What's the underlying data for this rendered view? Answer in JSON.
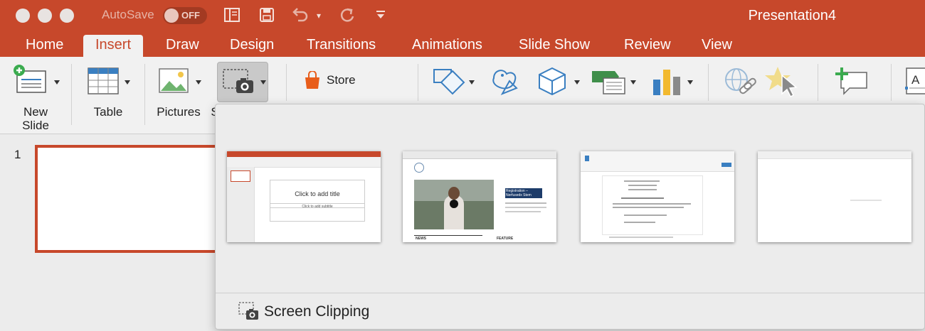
{
  "titlebar": {
    "autosave_label": "AutoSave",
    "toggle_state": "OFF",
    "document_title": "Presentation4"
  },
  "tabs": [
    {
      "label": "Home"
    },
    {
      "label": "Insert"
    },
    {
      "label": "Draw"
    },
    {
      "label": "Design"
    },
    {
      "label": "Transitions"
    },
    {
      "label": "Animations"
    },
    {
      "label": "Slide Show"
    },
    {
      "label": "Review"
    },
    {
      "label": "View"
    }
  ],
  "active_tab": "Insert",
  "ribbon": {
    "new_slide_line1": "New",
    "new_slide_line2": "Slide",
    "table_label": "Table",
    "pictures_label": "Pictures",
    "screenshot_label_partial": "S",
    "store_label": "Store"
  },
  "slides_panel": {
    "slide_number": "1"
  },
  "screenshot_dropdown": {
    "thumb1_title": "Click to add title",
    "thumb1_subtitle": "Click to add subtitle",
    "thumb2_heading": "Registration – Nerfusedx Stem",
    "thumb2_nav_news": "NEWS",
    "thumb2_nav_feature": "FEATURE",
    "screen_clipping_label": "Screen Clipping"
  },
  "colors": {
    "accent": "#c7482b",
    "ribbon_bg": "#f1f1f1",
    "pane_bg": "#ececec"
  },
  "icons": [
    "new-slide-icon",
    "table-icon",
    "pictures-icon",
    "screenshot-icon",
    "store-icon",
    "shapes-icon",
    "icons-icon",
    "3d-models-icon",
    "smartart-icon",
    "chart-icon",
    "link-icon",
    "action-icon",
    "comment-icon",
    "textbox-icon"
  ]
}
